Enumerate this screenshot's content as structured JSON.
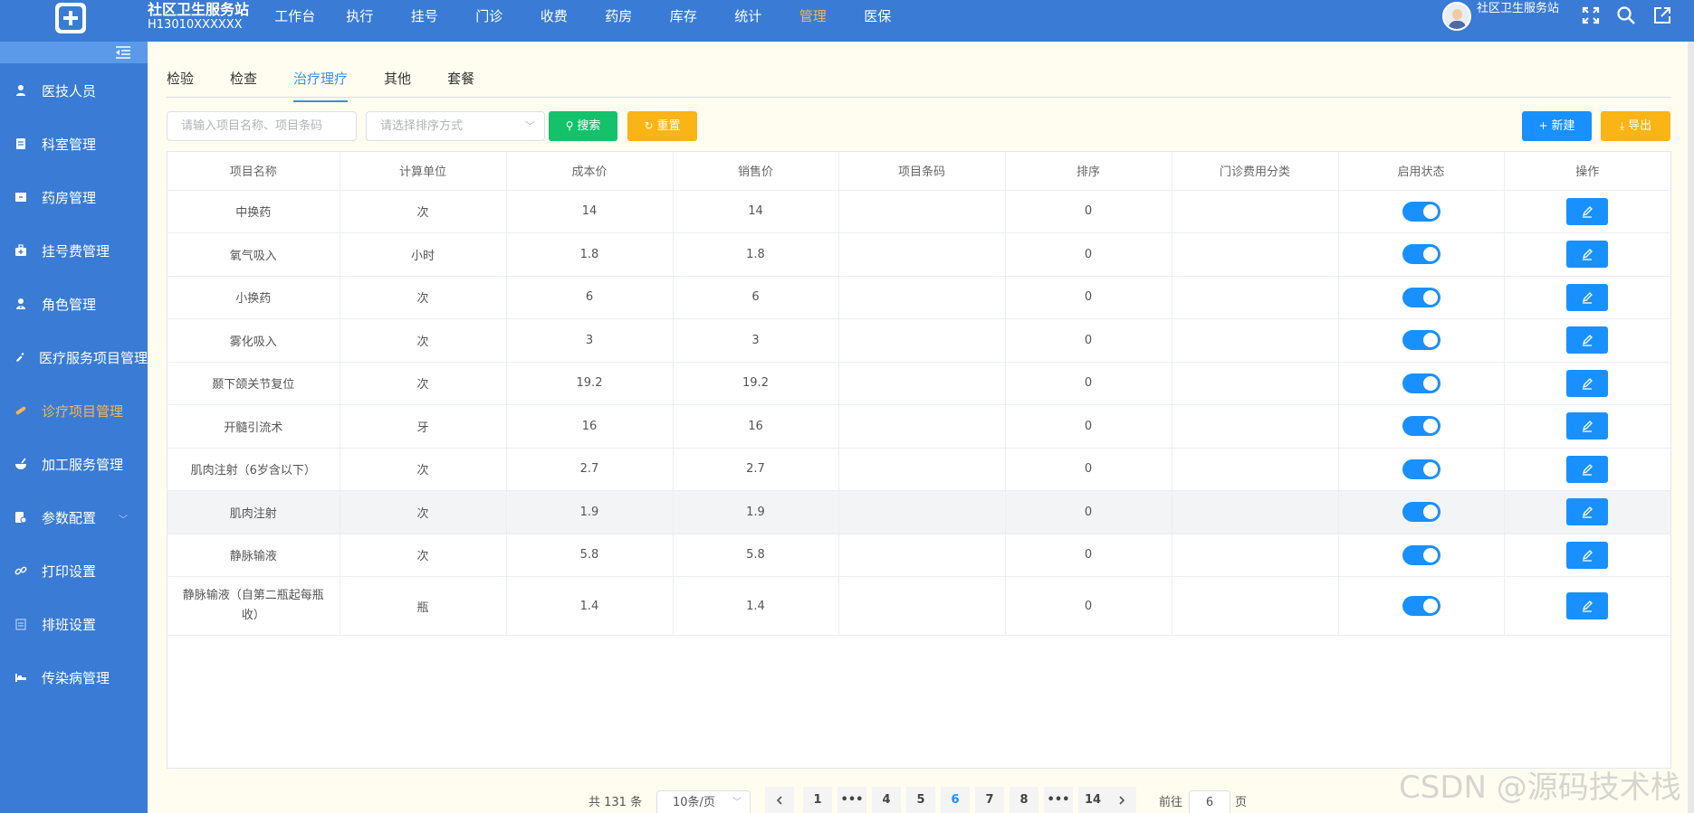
{
  "header": {
    "site_title": "社区卫生服务站",
    "site_code": "H13010XXXXXX",
    "nav": [
      "工作台",
      "执行",
      "挂号",
      "门诊",
      "收费",
      "药房",
      "库存",
      "统计",
      "管理",
      "医保"
    ],
    "active_nav": "管理",
    "user_name": "社区卫生服务站"
  },
  "sidebar": {
    "items": [
      {
        "label": "医技人员",
        "icon": "person-icon"
      },
      {
        "label": "科室管理",
        "icon": "document-icon"
      },
      {
        "label": "药房管理",
        "icon": "box-icon"
      },
      {
        "label": "挂号费管理",
        "icon": "medical-bag-icon"
      },
      {
        "label": "角色管理",
        "icon": "user-role-icon"
      },
      {
        "label": "医疗服务项目管理",
        "icon": "syringe-icon"
      },
      {
        "label": "诊疗项目管理",
        "icon": "bandage-icon"
      },
      {
        "label": "加工服务管理",
        "icon": "mortar-icon"
      },
      {
        "label": "参数配置",
        "icon": "settings-doc-icon"
      },
      {
        "label": "打印设置",
        "icon": "link-icon"
      },
      {
        "label": "排班设置",
        "icon": "calendar-icon"
      },
      {
        "label": "传染病管理",
        "icon": "bed-icon"
      }
    ],
    "active_item": "诊疗项目管理"
  },
  "tabs": [
    "检验",
    "检查",
    "治疗理疗",
    "其他",
    "套餐"
  ],
  "active_tab": "治疗理疗",
  "toolbar": {
    "search_placeholder": "请输入项目名称、项目条码",
    "sort_placeholder": "请选择排序方式",
    "search_label": "搜索",
    "reset_label": "重置",
    "new_label": "新建",
    "export_label": "导出"
  },
  "table": {
    "headers": [
      "项目名称",
      "计算单位",
      "成本价",
      "销售价",
      "项目条码",
      "排序",
      "门诊费用分类",
      "启用状态",
      "操作"
    ],
    "rows": [
      {
        "name": "中换药",
        "unit": "次",
        "cost": "14",
        "price": "14",
        "code": "",
        "sort": "0",
        "category": "",
        "enabled": true
      },
      {
        "name": "氧气吸入",
        "unit": "小时",
        "cost": "1.8",
        "price": "1.8",
        "code": "",
        "sort": "0",
        "category": "",
        "enabled": true
      },
      {
        "name": "小换药",
        "unit": "次",
        "cost": "6",
        "price": "6",
        "code": "",
        "sort": "0",
        "category": "",
        "enabled": true
      },
      {
        "name": "雾化吸入",
        "unit": "次",
        "cost": "3",
        "price": "3",
        "code": "",
        "sort": "0",
        "category": "",
        "enabled": true
      },
      {
        "name": "颞下颌关节复位",
        "unit": "次",
        "cost": "19.2",
        "price": "19.2",
        "code": "",
        "sort": "0",
        "category": "",
        "enabled": true
      },
      {
        "name": "开髓引流术",
        "unit": "牙",
        "cost": "16",
        "price": "16",
        "code": "",
        "sort": "0",
        "category": "",
        "enabled": true
      },
      {
        "name": "肌肉注射（6岁含以下）",
        "unit": "次",
        "cost": "2.7",
        "price": "2.7",
        "code": "",
        "sort": "0",
        "category": "",
        "enabled": true
      },
      {
        "name": "肌肉注射",
        "unit": "次",
        "cost": "1.9",
        "price": "1.9",
        "code": "",
        "sort": "0",
        "category": "",
        "enabled": true
      },
      {
        "name": "静脉输液",
        "unit": "次",
        "cost": "5.8",
        "price": "5.8",
        "code": "",
        "sort": "0",
        "category": "",
        "enabled": true
      },
      {
        "name": "静脉输液（自第二瓶起每瓶收）",
        "unit": "瓶",
        "cost": "1.4",
        "price": "1.4",
        "code": "",
        "sort": "0",
        "category": "",
        "enabled": true
      }
    ]
  },
  "pagination": {
    "total_text": "共 131 条",
    "page_size": "10条/页",
    "pages": [
      "1",
      "•••",
      "4",
      "5",
      "6",
      "7",
      "8",
      "•••",
      "14"
    ],
    "current_page": "6",
    "goto_label": "前往",
    "goto_value": "6",
    "page_suffix": "页"
  },
  "watermark": "CSDN @源码技术栈",
  "colors": {
    "primary": "#3a7bd5",
    "active_nav": "#f5b84a",
    "search_btn": "#13c26b",
    "reset_btn": "#fbb415",
    "new_btn": "#1890ff"
  }
}
